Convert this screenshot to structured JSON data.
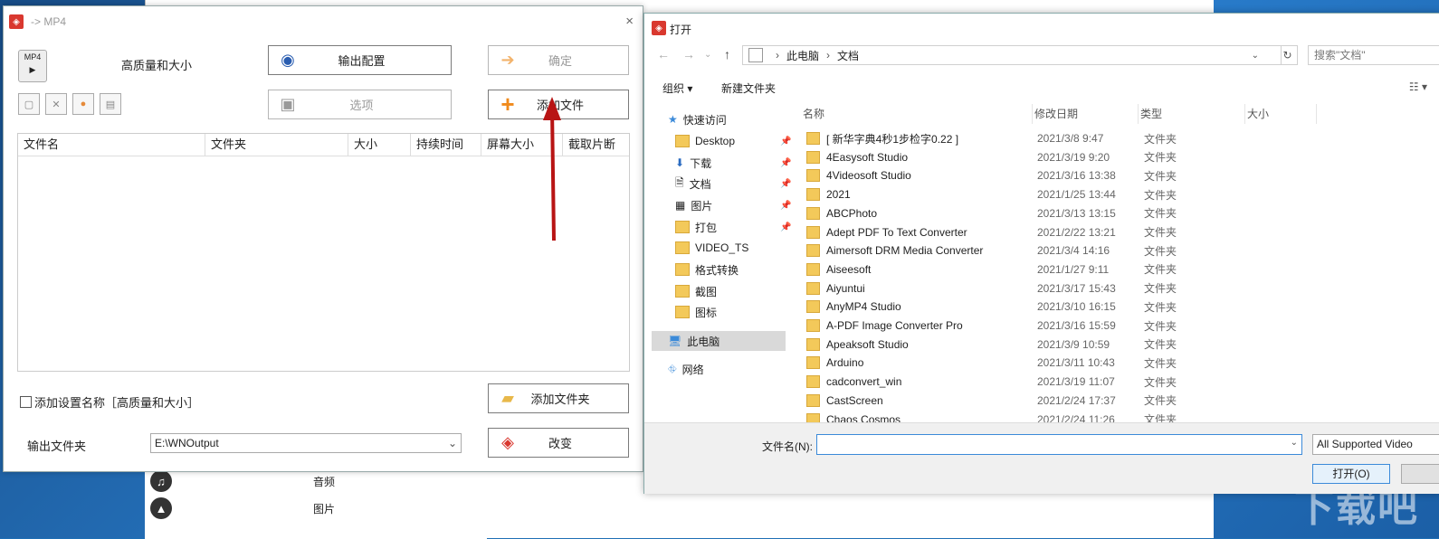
{
  "converter": {
    "title": "-> MP4",
    "close": "×",
    "profile_name": "高质量和大小",
    "btn_output_config": "输出配置",
    "btn_confirm": "确定",
    "btn_options": "选项",
    "btn_add_file": "添加文件",
    "columns": [
      "文件名",
      "文件夹",
      "大小",
      "持续时间",
      "屏幕大小",
      "截取片断"
    ],
    "checkbox_label": "添加设置名称［高质量和大小］",
    "btn_add_folder": "添加文件夹",
    "output_folder_label": "输出文件夹",
    "output_folder_value": "E:\\WNOutput",
    "btn_change": "改变"
  },
  "background_app": {
    "items": [
      {
        "label": "音频",
        "icon": "music-icon"
      },
      {
        "label": "图片",
        "icon": "image-icon"
      }
    ]
  },
  "dialog": {
    "title": "打开",
    "breadcrumb": [
      "此电脑",
      "文档"
    ],
    "search_placeholder": "搜索\"文档\"",
    "organize": "组织 ▾",
    "new_folder": "新建文件夹",
    "nav": {
      "quick_access": "快速访问",
      "items": [
        "Desktop",
        "下载",
        "文档",
        "图片",
        "打包",
        "VIDEO_TS",
        "格式转换",
        "截图",
        "图标"
      ],
      "this_pc": "此电脑",
      "network": "网络"
    },
    "columns": [
      "名称",
      "修改日期",
      "类型",
      "大小"
    ],
    "files": [
      {
        "name": "[ 新华字典4秒1步检字0.22 ]",
        "date": "2021/3/8 9:47",
        "type": "文件夹"
      },
      {
        "name": "4Easysoft Studio",
        "date": "2021/3/19 9:20",
        "type": "文件夹"
      },
      {
        "name": "4Videosoft Studio",
        "date": "2021/3/16 13:38",
        "type": "文件夹"
      },
      {
        "name": "2021",
        "date": "2021/1/25 13:44",
        "type": "文件夹"
      },
      {
        "name": "ABCPhoto",
        "date": "2021/3/13 13:15",
        "type": "文件夹"
      },
      {
        "name": "Adept PDF To Text Converter",
        "date": "2021/2/22 13:21",
        "type": "文件夹"
      },
      {
        "name": "Aimersoft DRM Media Converter",
        "date": "2021/3/4 14:16",
        "type": "文件夹"
      },
      {
        "name": "Aiseesoft",
        "date": "2021/1/27 9:11",
        "type": "文件夹"
      },
      {
        "name": "Aiyuntui",
        "date": "2021/3/17 15:43",
        "type": "文件夹"
      },
      {
        "name": "AnyMP4 Studio",
        "date": "2021/3/10 16:15",
        "type": "文件夹"
      },
      {
        "name": "A-PDF Image Converter Pro",
        "date": "2021/3/16 15:59",
        "type": "文件夹"
      },
      {
        "name": "Apeaksoft Studio",
        "date": "2021/3/9 10:59",
        "type": "文件夹"
      },
      {
        "name": "Arduino",
        "date": "2021/3/11 10:43",
        "type": "文件夹"
      },
      {
        "name": "cadconvert_win",
        "date": "2021/3/19 11:07",
        "type": "文件夹"
      },
      {
        "name": "CastScreen",
        "date": "2021/2/24 17:37",
        "type": "文件夹"
      },
      {
        "name": "Chaos Cosmos",
        "date": "2021/2/24 11:26",
        "type": "文件夹"
      }
    ],
    "filename_label": "文件名(N):",
    "filter_value": "All Supported Video",
    "open_button": "打开(O)"
  },
  "watermark": "下载吧"
}
